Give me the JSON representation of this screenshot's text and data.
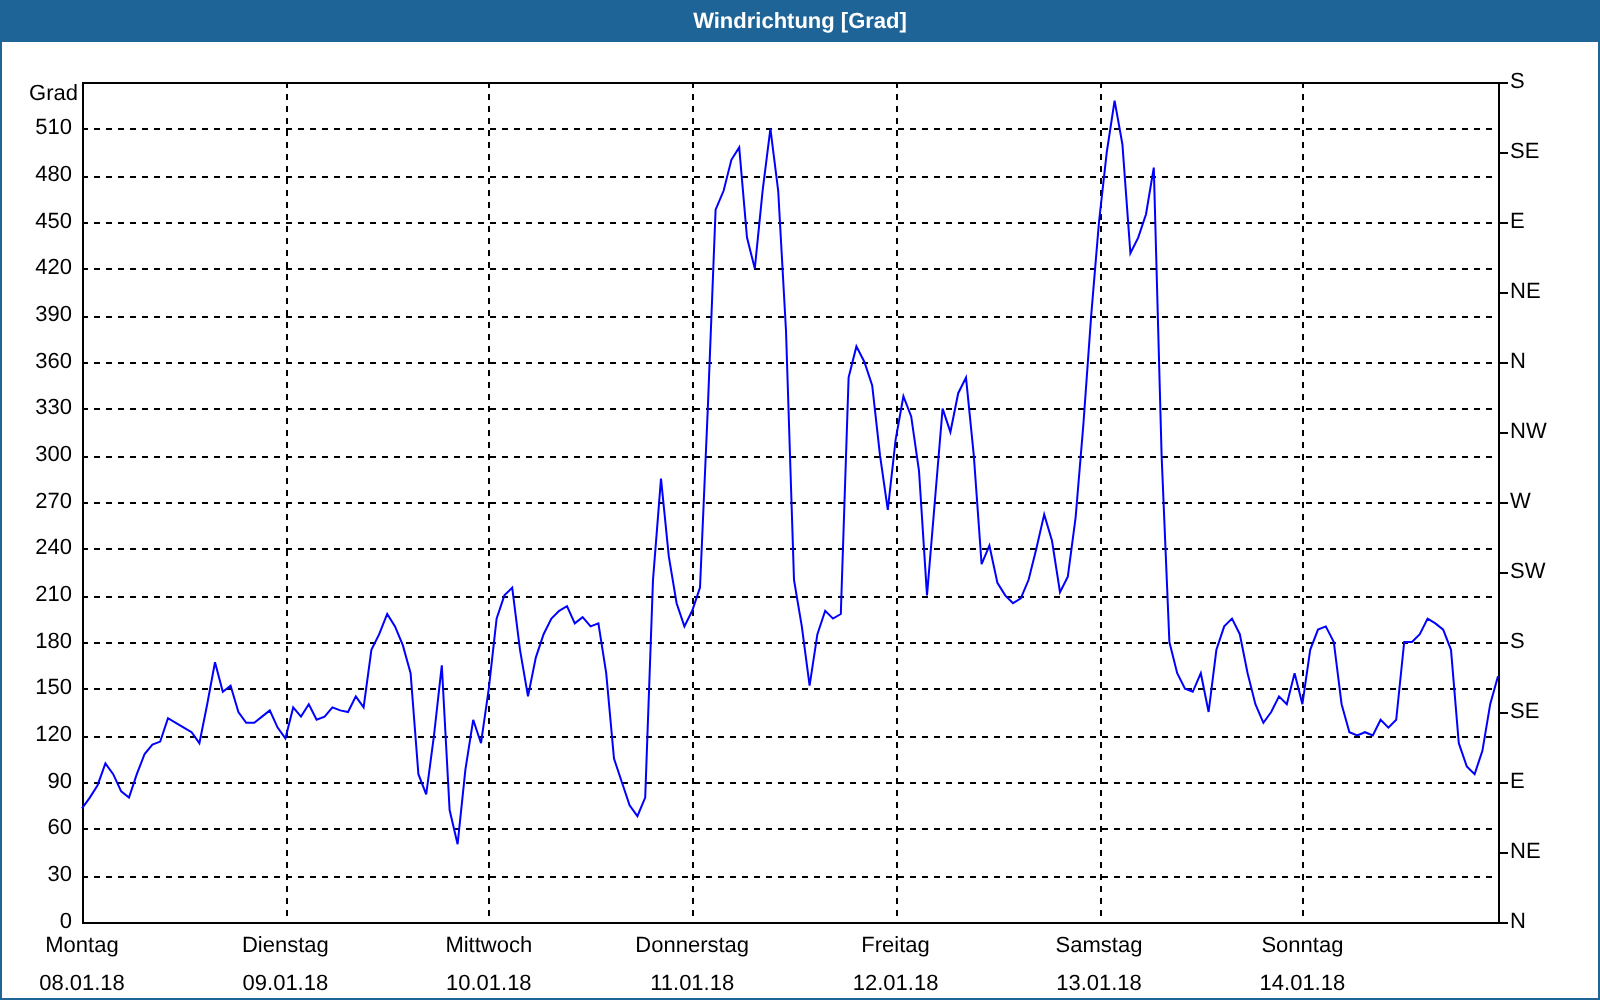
{
  "window": {
    "title": "Windrichtung [Grad]"
  },
  "chart": {
    "chart_data": {
      "type": "line",
      "grid": true,
      "ylabel": "Grad",
      "ylim": [
        0,
        540
      ],
      "yticks": [
        0,
        30,
        60,
        90,
        120,
        150,
        180,
        210,
        240,
        270,
        300,
        330,
        360,
        390,
        420,
        450,
        480,
        510
      ],
      "categories": [
        "Montag\n08.01.18",
        null,
        null,
        null,
        null,
        null,
        null,
        null,
        null,
        null,
        null,
        null,
        null,
        null,
        null,
        null,
        null,
        null,
        null,
        null,
        null,
        null,
        null,
        null,
        null,
        null,
        "Dienstag\n09.01.18",
        null,
        null,
        null,
        null,
        null,
        null,
        null,
        null,
        null,
        null,
        null,
        null,
        null,
        null,
        null,
        null,
        null,
        null,
        null,
        null,
        null,
        null,
        null,
        null,
        null,
        "Mittwoch\n10.01.18",
        null,
        null,
        null,
        null,
        null,
        null,
        null,
        null,
        null,
        null,
        null,
        null,
        null,
        null,
        null,
        null,
        null,
        null,
        null,
        null,
        null,
        null,
        null,
        null,
        null,
        "Donnerstag\n11.01.18",
        null,
        null,
        null,
        null,
        null,
        null,
        null,
        null,
        null,
        null,
        null,
        null,
        null,
        null,
        null,
        null,
        null,
        null,
        null,
        null,
        null,
        null,
        null,
        null,
        null,
        "Freitag\n12.01.18",
        null,
        null,
        null,
        null,
        null,
        null,
        null,
        null,
        null,
        null,
        null,
        null,
        null,
        null,
        null,
        null,
        null,
        null,
        null,
        null,
        null,
        null,
        null,
        null,
        null,
        "Samstag\n13.01.18",
        null,
        null,
        null,
        null,
        null,
        null,
        null,
        null,
        null,
        null,
        null,
        null,
        null,
        null,
        null,
        null,
        null,
        null,
        null,
        null,
        null,
        null,
        null,
        null,
        null,
        "Sonntag\n14.01.18",
        null,
        null,
        null,
        null,
        null,
        null,
        null,
        null,
        null,
        null,
        null,
        null,
        null,
        null,
        null,
        null,
        null,
        null,
        null,
        null,
        null,
        null,
        null,
        null,
        null
      ],
      "series": [
        {
          "color": "#0000ff",
          "values": [
            73,
            80,
            88,
            102,
            95,
            84,
            80,
            95,
            108,
            114,
            116,
            131,
            128,
            125,
            122,
            115,
            140,
            167,
            148,
            152,
            135,
            128,
            128,
            132,
            136,
            125,
            118,
            138,
            132,
            140,
            130,
            132,
            138,
            136,
            135,
            145,
            138,
            175,
            185,
            198,
            190,
            178,
            160,
            95,
            82,
            120,
            165,
            72,
            50,
            98,
            130,
            115,
            150,
            195,
            210,
            215,
            175,
            145,
            170,
            185,
            195,
            200,
            203,
            192,
            196,
            190,
            192,
            160,
            105,
            90,
            75,
            68,
            80,
            220,
            285,
            235,
            205,
            190,
            200,
            215,
            330,
            458,
            470,
            490,
            498,
            440,
            420,
            470,
            510,
            470,
            380,
            220,
            190,
            152,
            185,
            200,
            195,
            198,
            350,
            370,
            360,
            345,
            300,
            265,
            310,
            338,
            325,
            290,
            210,
            270,
            330,
            315,
            340,
            350,
            300,
            230,
            242,
            218,
            210,
            205,
            208,
            220,
            240,
            262,
            245,
            212,
            222,
            260,
            320,
            390,
            450,
            495,
            528,
            500,
            430,
            440,
            455,
            485,
            300,
            180,
            160,
            150,
            148,
            160,
            135,
            175,
            190,
            195,
            185,
            160,
            140,
            128,
            135,
            145,
            140,
            160,
            140,
            175,
            188,
            190,
            180,
            140,
            122,
            120,
            122,
            120,
            130,
            125,
            130,
            180,
            180,
            185,
            195,
            192,
            188,
            175,
            115,
            100,
            95,
            110,
            140,
            158
          ]
        }
      ]
    },
    "compass_labels": [
      "S",
      "SE",
      "E",
      "NE",
      "N",
      "NW",
      "W",
      "SW",
      "S",
      "SE",
      "E",
      "NE",
      "N"
    ]
  }
}
